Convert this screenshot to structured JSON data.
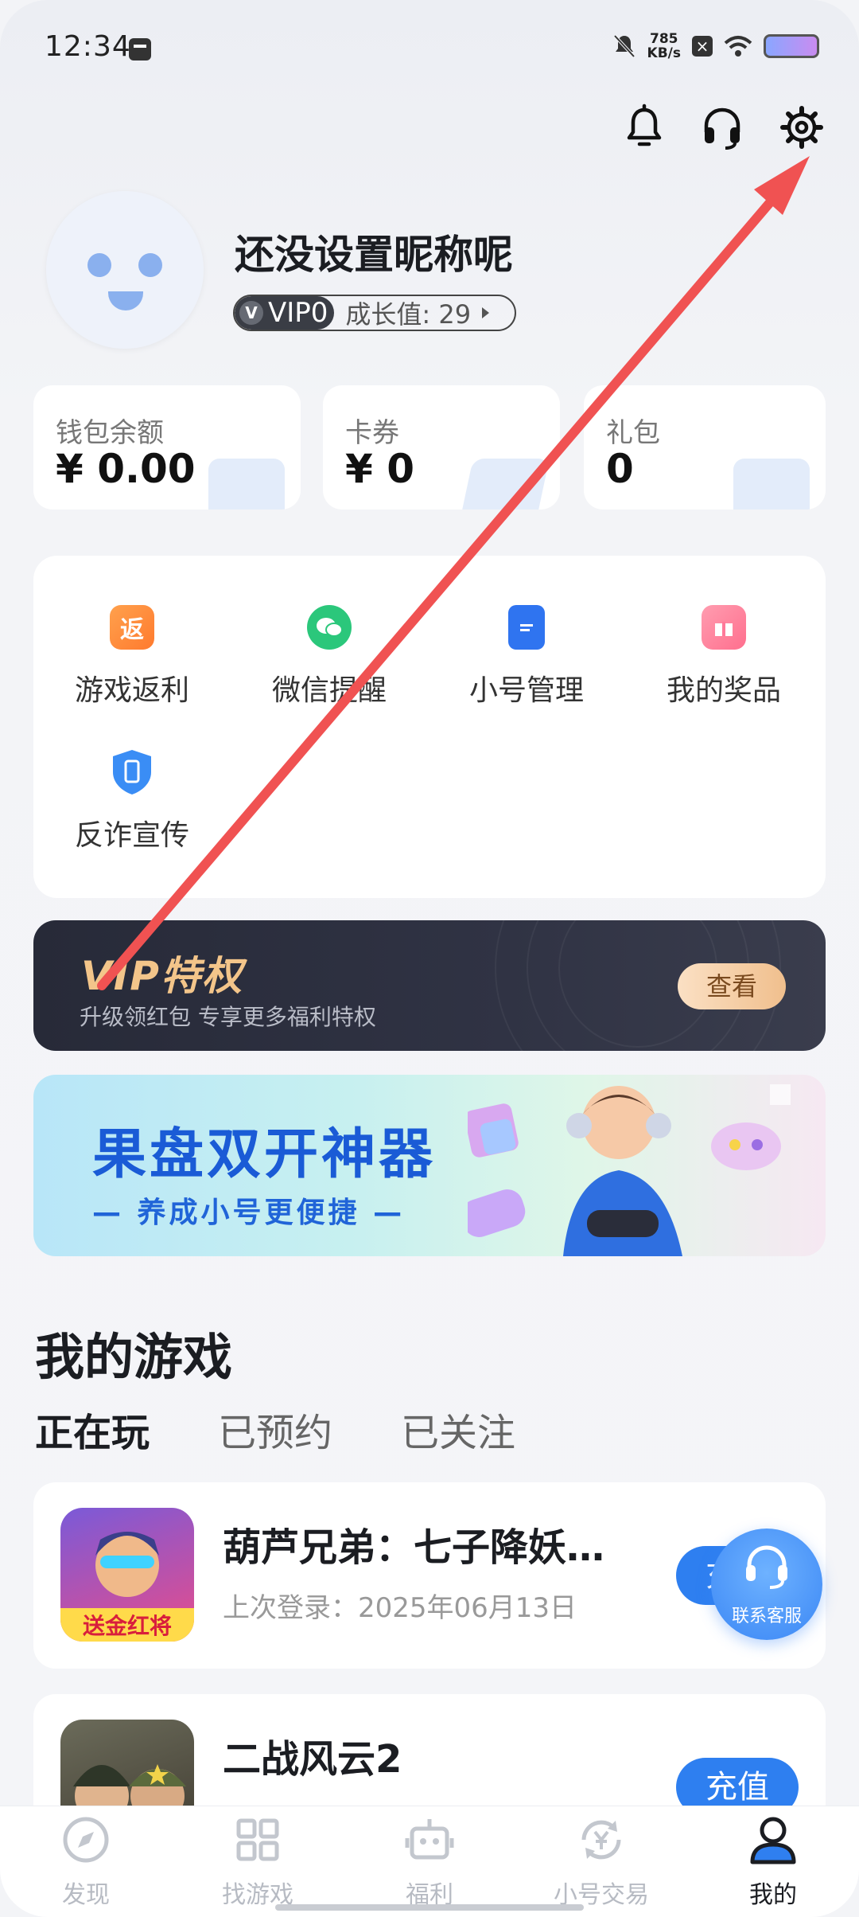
{
  "status_bar": {
    "time": "12:34",
    "speed_value": "785",
    "speed_unit": "KB/s"
  },
  "header_icons": [
    "bell-icon",
    "headset-icon",
    "settings-gear-icon"
  ],
  "profile": {
    "nickname": "还没设置昵称呢",
    "vip_level": "VIP0",
    "vip_badge": "V",
    "growth": "成长值: 29"
  },
  "stats": [
    {
      "label": "钱包余额",
      "value": "¥ 0.00"
    },
    {
      "label": "卡券",
      "value": "¥ 0"
    },
    {
      "label": "礼包",
      "value": "0"
    }
  ],
  "menu": [
    {
      "label": "游戏返利",
      "icon": "rebate-icon",
      "glyph": "返",
      "color": "#ff8a3d"
    },
    {
      "label": "微信提醒",
      "icon": "wechat-icon",
      "glyph": "",
      "color": "#2bc77b"
    },
    {
      "label": "小号管理",
      "icon": "clipboard-icon",
      "glyph": "",
      "color": "#2f74f0"
    },
    {
      "label": "我的奖品",
      "icon": "gift-icon",
      "glyph": "",
      "color": "#ff7aa6"
    },
    {
      "label": "反诈宣传",
      "icon": "shield-phone-icon",
      "glyph": "",
      "color": "#3a8df5"
    }
  ],
  "vip_banner": {
    "title": "VIP特权",
    "subtitle": "升级领红包 专享更多福利特权",
    "button": "查看"
  },
  "promo": {
    "title": "果盘双开神器",
    "subtitle": "— 养成小号更便捷 —"
  },
  "my_games": {
    "title": "我的游戏",
    "tabs": [
      "正在玩",
      "已预约",
      "已关注"
    ],
    "games": [
      {
        "name": "葫芦兄弟：七子降妖…",
        "meta": "上次登录：2025年06月13日",
        "button": "充值",
        "thumb_text": "送金红将"
      },
      {
        "name": "二战风云2",
        "meta": "",
        "button": "充值",
        "thumb_text": ""
      }
    ]
  },
  "float_service": {
    "label": "联系客服"
  },
  "bottom_nav": [
    {
      "label": "发现",
      "icon": "compass-icon"
    },
    {
      "label": "找游戏",
      "icon": "grid-icon"
    },
    {
      "label": "福利",
      "icon": "robot-icon"
    },
    {
      "label": "小号交易",
      "icon": "yuan-exchange-icon"
    },
    {
      "label": "我的",
      "icon": "person-icon",
      "active": true
    }
  ],
  "colors": {
    "accent": "#2e7ff0",
    "vip_gold": "#f3c58a",
    "annotation_arrow": "#f05252"
  }
}
